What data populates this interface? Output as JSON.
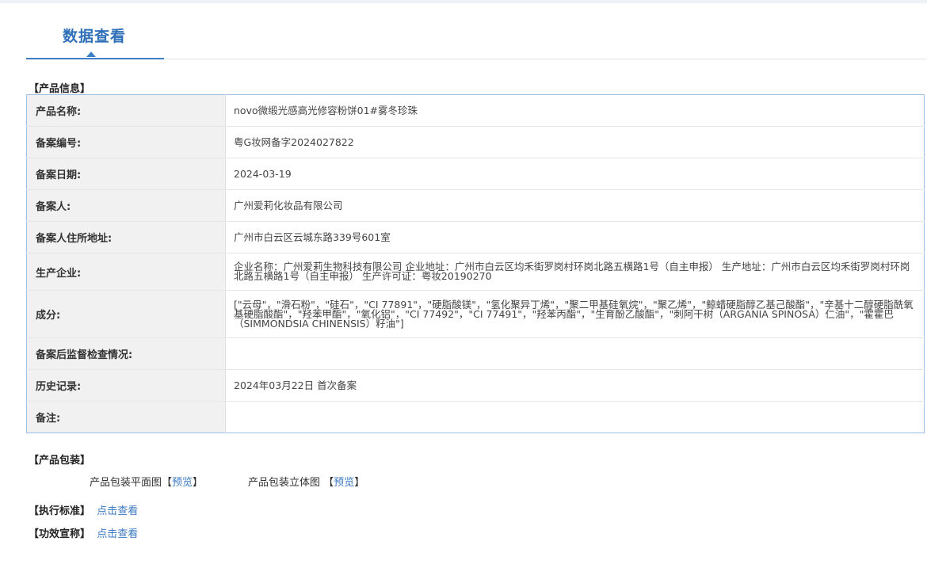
{
  "tab": {
    "title": "数据查看"
  },
  "product_info": {
    "section_title": "【产品信息】",
    "rows": [
      {
        "label": "产品名称:",
        "value": "novo微缎光感高光修容粉饼01#雾冬珍珠"
      },
      {
        "label": "备案编号:",
        "value": "粤G妆网备字2024027822"
      },
      {
        "label": "备案日期:",
        "value": "2024-03-19"
      },
      {
        "label": "备案人:",
        "value": "广州爱莉化妆品有限公司"
      },
      {
        "label": "备案人住所地址:",
        "value": "广州市白云区云城东路339号601室"
      },
      {
        "label": "生产企业:",
        "value": "企业名称：广州爱莉生物科技有限公司 企业地址：广州市白云区均禾街罗岗村环岗北路五横路1号（自主申报） 生产地址：广州市白云区均禾街罗岗村环岗北路五横路1号（自主申报） 生产许可证：粤妆20190270"
      },
      {
        "label": "成分:",
        "value": "[\"云母\"，\"滑石粉\"，\"硅石\"，\"CI 77891\"，\"硬脂酸镁\"，\"氢化聚异丁烯\"，\"聚二甲基硅氧烷\"，\"聚乙烯\"，\"鲸蜡硬脂醇乙基己酸酯\"，\"辛基十二醇硬脂酰氧基硬脂酸酯\"，\"羟苯甲酯\"，\"氧化铝\"，\"CI 77492\"，\"CI 77491\"，\"羟苯丙酯\"，\"生育酚乙酸酯\"，\"刺阿干树（ARGANIA SPINOSA）仁油\"，\"霍霍巴（SIMMONDSIA CHINENSIS）籽油\"]"
      },
      {
        "label": "备案后监督检查情况:",
        "value": ""
      },
      {
        "label": "历史记录:",
        "value": "2024年03月22日 首次备案"
      },
      {
        "label": "备注:",
        "value": ""
      }
    ]
  },
  "packaging": {
    "section_title": "【产品包装】",
    "flat_label": "产品包装平面图",
    "stereo_label": "产品包装立体图",
    "bracket_open": "【",
    "bracket_close": "】",
    "preview_link": "预览"
  },
  "standard": {
    "label": "【执行标准】",
    "link": "点击查看"
  },
  "efficacy": {
    "label": "【功效宣称】",
    "link": "点击查看"
  }
}
